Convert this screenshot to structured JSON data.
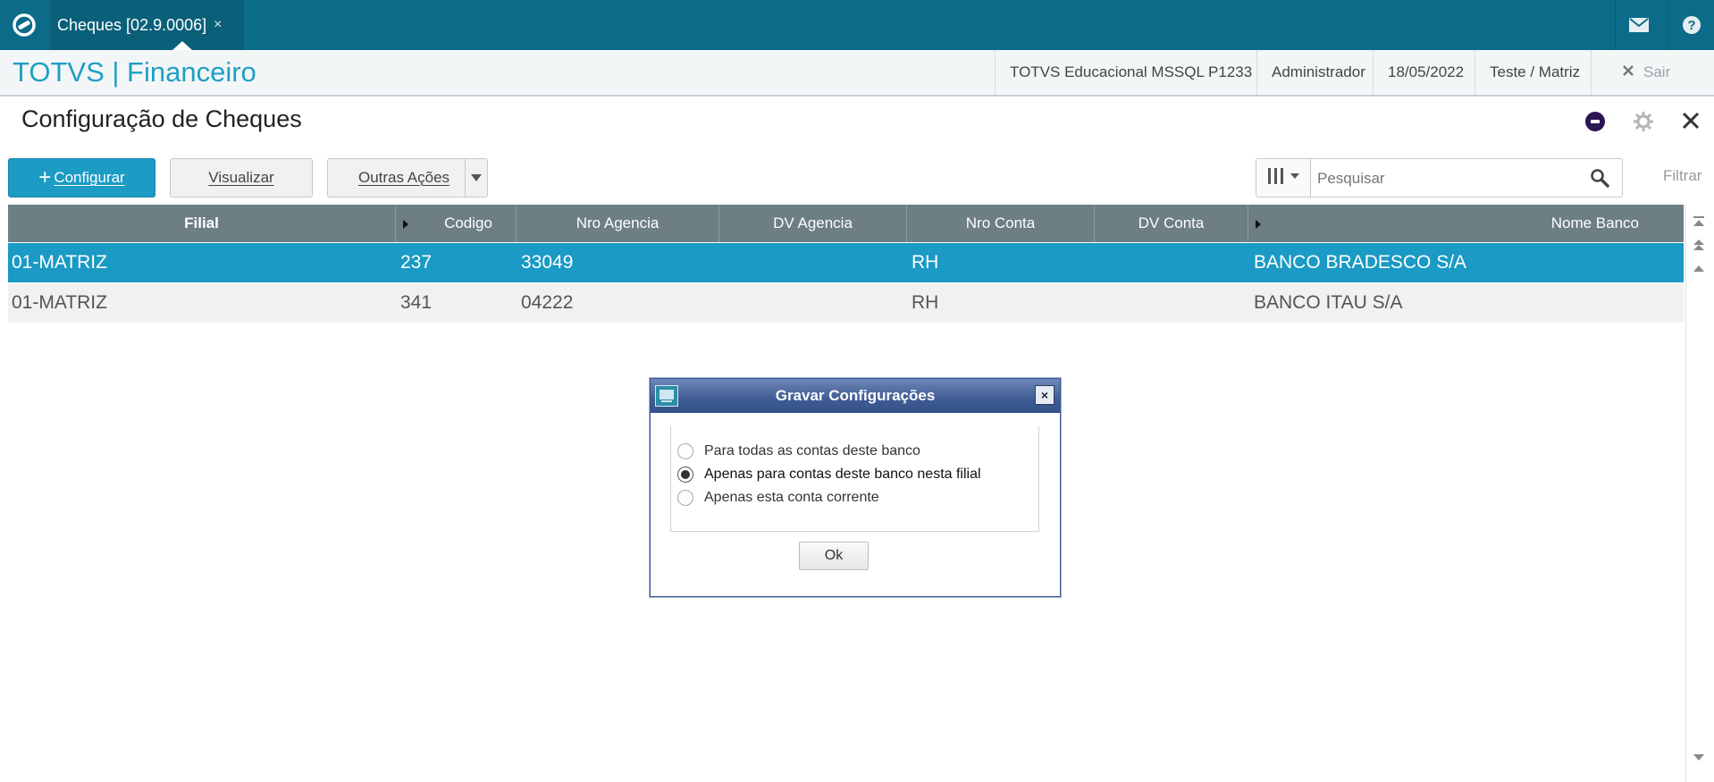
{
  "topbar": {
    "tab_label": "Cheques [02.9.0006]",
    "tab_close": "×"
  },
  "header": {
    "app_title": "TOTVS | Financeiro",
    "environment": "TOTVS Educacional MSSQL P1233",
    "user": "Administrador",
    "date": "18/05/2022",
    "branch": "Teste / Matriz",
    "logout_label": "Sair"
  },
  "page": {
    "title": "Configuração de Cheques"
  },
  "toolbar": {
    "configure_label": "Configurar",
    "view_label": "Visualizar",
    "other_actions_label": "Outras Ações",
    "search_placeholder": "Pesquisar",
    "filter_label": "Filtrar"
  },
  "grid": {
    "columns": [
      "Filial",
      "Codigo",
      "Nro Agencia",
      "DV Agencia",
      "Nro Conta",
      "DV Conta",
      "Nome Banco"
    ],
    "rows": [
      {
        "filial": "01-MATRIZ",
        "codigo": "237",
        "nro_agencia": "33049",
        "dv_agencia": "",
        "nro_conta": "RH",
        "dv_conta": "",
        "nome_banco": "BANCO BRADESCO S/A",
        "selected": true
      },
      {
        "filial": "01-MATRIZ",
        "codigo": "341",
        "nro_agencia": "04222",
        "dv_agencia": "",
        "nro_conta": "RH",
        "dv_conta": "",
        "nome_banco": "BANCO ITAU S/A",
        "selected": false
      }
    ]
  },
  "dialog": {
    "title": "Gravar Configurações",
    "close": "×",
    "options": [
      {
        "label": "Para todas as contas deste banco",
        "checked": false
      },
      {
        "label": "Apenas para contas deste banco nesta filial",
        "checked": true
      },
      {
        "label": "Apenas esta conta corrente",
        "checked": false
      }
    ],
    "ok_label": "Ok"
  },
  "colors": {
    "topbar": "#0b6b88",
    "accent": "#1c9bc4",
    "grid_header": "#6d7e85",
    "dialog_title": "#3f5c93"
  }
}
